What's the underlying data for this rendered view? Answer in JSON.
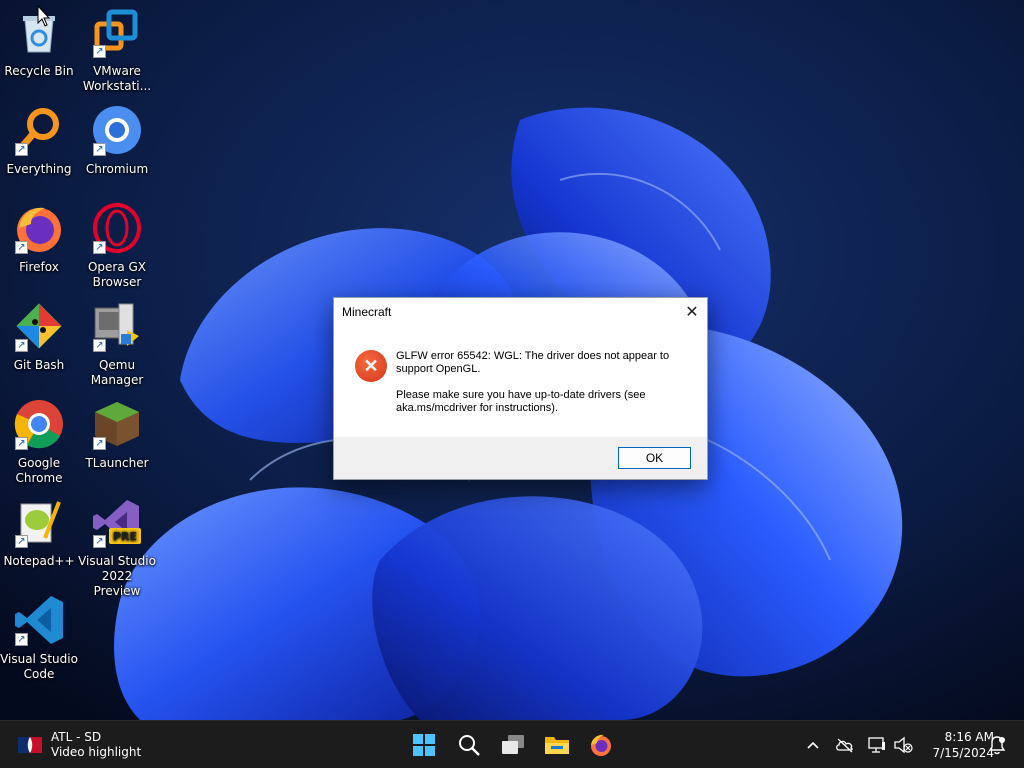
{
  "desktop": {
    "icons": [
      {
        "label": "Recycle Bin",
        "icon": "recycle-bin-icon"
      },
      {
        "label": "VMware\nWorkstati...",
        "icon": "vmware-icon"
      },
      {
        "label": "Everything",
        "icon": "everything-search-icon"
      },
      {
        "label": "Chromium",
        "icon": "chromium-icon"
      },
      {
        "label": "Firefox",
        "icon": "firefox-icon"
      },
      {
        "label": "Opera GX\nBrowser",
        "icon": "opera-gx-icon"
      },
      {
        "label": "Git Bash",
        "icon": "git-bash-icon"
      },
      {
        "label": "Qemu\nManager",
        "icon": "qemu-manager-icon"
      },
      {
        "label": "Google\nChrome",
        "icon": "chrome-icon"
      },
      {
        "label": "TLauncher",
        "icon": "tlauncher-icon"
      },
      {
        "label": "Notepad++",
        "icon": "notepadpp-icon"
      },
      {
        "label": "Visual Studio\n2022 Preview",
        "icon": "visual-studio-preview-icon"
      },
      {
        "label": "Visual Studio\nCode",
        "icon": "vscode-icon"
      }
    ],
    "pre_badge": "PRE"
  },
  "dialog": {
    "title": "Minecraft",
    "message_line1": "GLFW error 65542: WGL: The driver does not appear to support OpenGL.",
    "message_line2": "Please make sure you have up-to-date drivers (see aka.ms/mcdriver for instructions).",
    "ok_label": "OK",
    "close_glyph": "✕"
  },
  "taskbar": {
    "widget_title": "ATL - SD",
    "widget_subtitle": "Video highlight",
    "pinned": [
      "start-icon",
      "search-icon",
      "task-view-icon",
      "file-explorer-icon",
      "firefox-icon"
    ],
    "tray": {
      "chevron": "^",
      "time": "8:16 AM",
      "date": "7/15/2024"
    }
  },
  "colors": {
    "taskbar_bg": "#1c1c1c",
    "error_icon": "#d6361c",
    "ok_border": "#0067c0",
    "wallpaper_bloom": "#1f47e6"
  }
}
